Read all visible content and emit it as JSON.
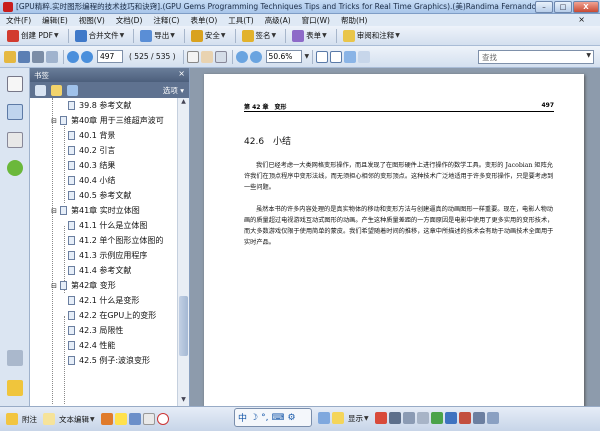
{
  "window": {
    "title": "[GPU精粹.实时图形编程的技术技巧和诀窍].(GPU Gems Programming Techniques Tips and Tricks for Real Time Graphics).(美)Randima Fernando.pdf - Adob",
    "min": "–",
    "max": "□",
    "close": "X"
  },
  "menu": [
    "文件(F)",
    "编辑(E)",
    "视图(V)",
    "文档(D)",
    "注释(C)",
    "表单(O)",
    "工具(T)",
    "高级(A)",
    "窗口(W)",
    "帮助(H)"
  ],
  "menu_close": "×",
  "toolbar1": {
    "create_pdf": "创建 PDF",
    "merge_files": "合并文件",
    "export": "导出",
    "secure": "安全",
    "sign": "签名",
    "forms": "表单",
    "review_comment": "审阅和注释"
  },
  "toolbar2": {
    "page_value": "497",
    "page_count": "( 525 / 535 )",
    "zoom_value": "50.6%",
    "search_placeholder": "查找"
  },
  "panel": {
    "title": "书签",
    "options": "选项",
    "close": "×"
  },
  "bookmarks": [
    {
      "label": "39.8 参考文献",
      "level": 2
    },
    {
      "label": "第40章 用于三维超声波可",
      "level": 1,
      "expander": "⊟"
    },
    {
      "label": "40.1 背景",
      "level": 2
    },
    {
      "label": "40.2 引言",
      "level": 2
    },
    {
      "label": "40.3 结果",
      "level": 2
    },
    {
      "label": "40.4 小结",
      "level": 2
    },
    {
      "label": "40.5 参考文献",
      "level": 2
    },
    {
      "label": "第41章 实时立体图",
      "level": 1,
      "expander": "⊟"
    },
    {
      "label": "41.1 什么是立体图",
      "level": 2
    },
    {
      "label": "41.2 单个图形立体图的",
      "level": 2
    },
    {
      "label": "41.3 示例应用程序",
      "level": 2
    },
    {
      "label": "41.4 参考文献",
      "level": 2
    },
    {
      "label": "第42章 变形",
      "level": 1,
      "expander": "⊟"
    },
    {
      "label": "42.1 什么是变形",
      "level": 2
    },
    {
      "label": "42.2 在GPU上的变形",
      "level": 2
    },
    {
      "label": "42.3 局限性",
      "level": 2
    },
    {
      "label": "42.4 性能",
      "level": 2
    },
    {
      "label": "42.5 例子:波浪变形",
      "level": 2
    }
  ],
  "page": {
    "running_head_left": "第 42 章　变形",
    "running_head_right": "497",
    "section_title": "42.6　小结",
    "paragraph1": "我们已经考虑一大类网格变形操作，而且发现了在图形硬件上进行操作的数学工具。变形的 Jacobian 矩阵允许我们在顶点程序中变形法线，而无须担心相邻的变形顶点。这种技术广泛地适用于许多变形操作，只是要考虑到一些问题。",
    "paragraph2": "虽然本书的许多内容处理的是真实物体的移动和变形方法与创建逼真的动画图形一样重要。现在，电影人物动画的质量超过电视游戏互动式图形的动画。产生这种质量差距的一方面原因是电影中使用了更多实用的变形技术，而大多数游戏仅限于使用简单的蒙皮。我们希望随着时间的推移，这章中所描述的技术会有助于动画技术全面用于实时产品。"
  },
  "bottombar": {
    "attach": "附注",
    "text_edit": "文本编辑",
    "show": "显示"
  },
  "ime": {
    "mode": "中",
    "moon": "☽",
    "punct": "°,",
    "keyboard": "⌨",
    "gear": "⚙"
  }
}
